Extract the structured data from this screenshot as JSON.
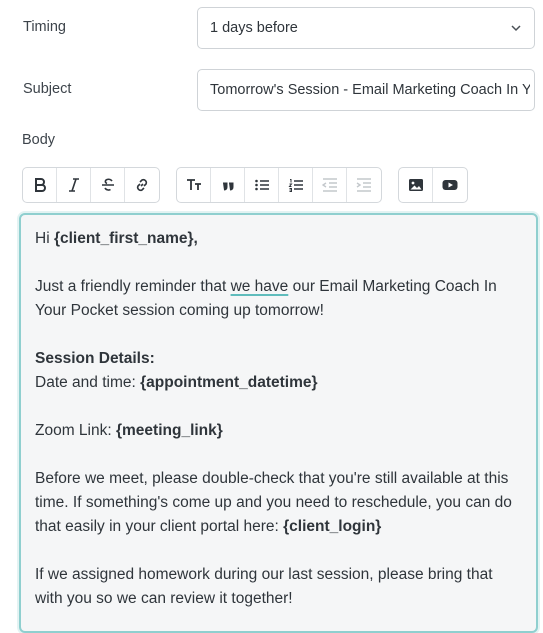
{
  "timing": {
    "label": "Timing",
    "value": "1 days before"
  },
  "subject": {
    "label": "Subject",
    "value": "Tomorrow's Session - Email Marketing Coach In Your Pocket"
  },
  "body_label": "Body",
  "toolbar": {
    "groups": [
      [
        "bold-icon",
        "italic-icon",
        "strikethrough-icon",
        "link-icon"
      ],
      [
        "text-size-icon",
        "quote-icon",
        "bullet-list-icon",
        "numbered-list-icon",
        "outdent-icon",
        "indent-icon"
      ],
      [
        "image-icon",
        "video-icon"
      ]
    ]
  },
  "body": {
    "greeting_prefix": "Hi ",
    "greeting_var": "{client_first_name},",
    "p1_a": "Just a friendly reminder that ",
    "p1_spell": "we have",
    "p1_b": " our Email Marketing Coach In Your Pocket session coming up tomorrow!",
    "details_heading": "Session Details:",
    "date_label": "Date and time: ",
    "date_var": "{appointment_datetime}",
    "zoom_label": "Zoom Link: ",
    "zoom_var": "{meeting_link}",
    "p2": "Before we meet, please double-check that you're still available at this time. If something's come up and you need to reschedule, you can do that easily in your client portal here: ",
    "login_var": "{client_login}",
    "p3": "If we assigned homework during our last session, please bring that with you so we can review it together!"
  }
}
